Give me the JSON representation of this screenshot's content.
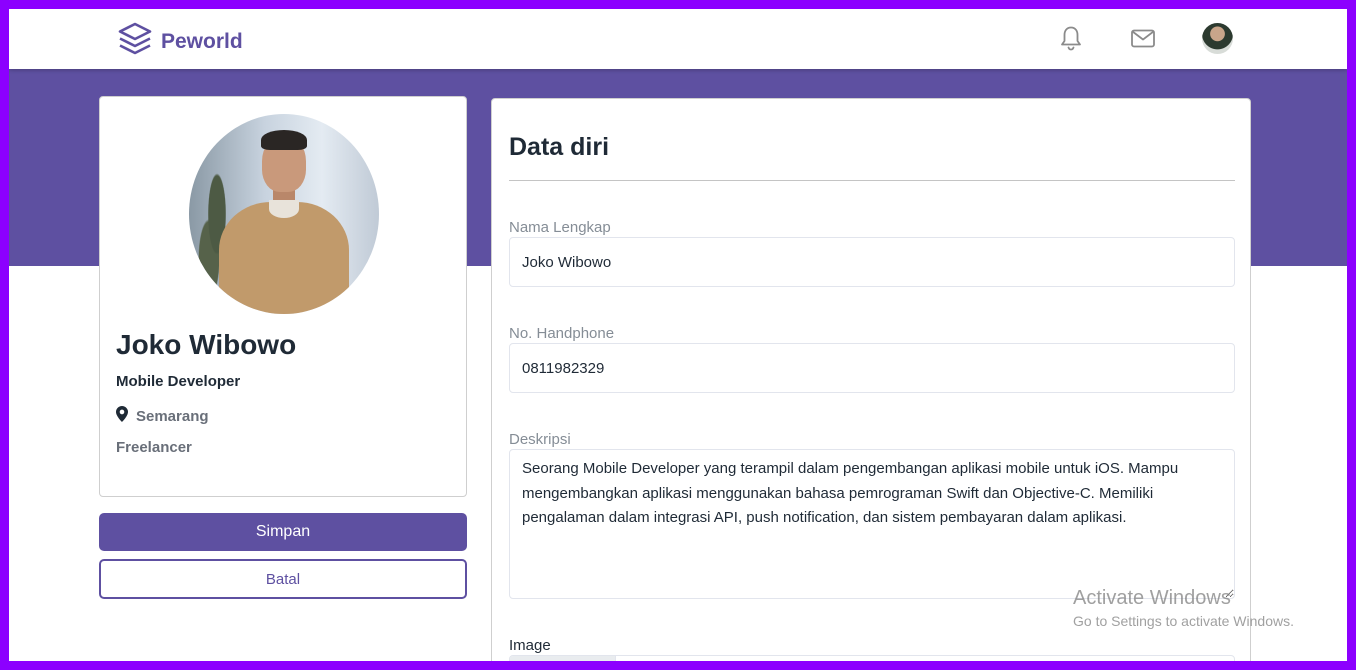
{
  "brand": {
    "name": "Peworld",
    "accent": "#5e50a1"
  },
  "nav": {
    "icons": [
      "layers-icon",
      "bell-icon",
      "mail-icon"
    ]
  },
  "profile": {
    "name": "Joko Wibowo",
    "job": "Mobile Developer",
    "location": "Semarang",
    "work_type": "Freelancer"
  },
  "actions": {
    "save_label": "Simpan",
    "cancel_label": "Batal"
  },
  "form": {
    "title": "Data diri",
    "full_name": {
      "label": "Nama Lengkap",
      "value": "Joko Wibowo"
    },
    "phone": {
      "label": "No. Handphone",
      "value": "0811982329"
    },
    "description": {
      "label": "Deskripsi",
      "value": "Seorang Mobile Developer yang terampil dalam pengembangan aplikasi mobile untuk iOS. Mampu mengembangkan aplikasi menggunakan bahasa pemrograman Swift dan Objective-C. Memiliki pengalaman dalam integrasi API, push notification, dan sistem pembayaran dalam aplikasi."
    },
    "image": {
      "label": "Image"
    }
  },
  "watermark": {
    "line1": "Activate Windows",
    "line2": "Go to Settings to activate Windows."
  }
}
